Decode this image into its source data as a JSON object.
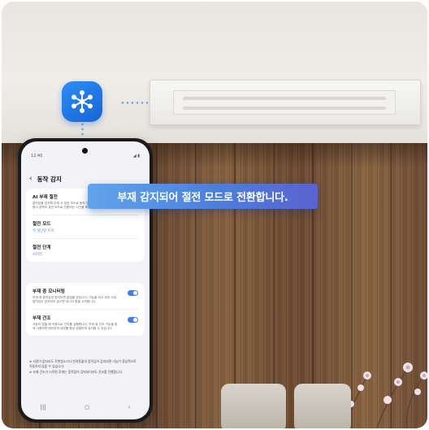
{
  "phone": {
    "status_time": "12:40",
    "status_icons": "◢ ▮",
    "header_title": "동작 감지",
    "ai_title": "AI 부재 절전",
    "ai_desc": "움직임을 감지해 부재 시 절전 모드로 동작 감지 바람 기능을 위한 사람이 공백이 절전 모드로 전환되는 시간을 확인합니다.",
    "mode_title": "절전 모드",
    "mode_value": "약 냉난방 유지",
    "level_title": "절전 단계",
    "level_value": "사이리",
    "monitor_title": "부재 중 모니터링",
    "monitor_desc": "부재 중 움직임이 감지되면 알림을 받습니다. 기능을 켜고 외부 이상 움직임이 감지되지 않으면 되니다 항을 시작합니다.",
    "dry_title": "부재 건조",
    "dry_desc": "사람이 없을 때 자동으로 건조를 실행합니다. 부재 중 건조 기능을 함께 사용하면 에어컨의 내부를 항상 청결하게 유지할 수 있습니다.",
    "note_1": "※ 사람이 없더라도 로봇청소기나 반려동물의 움직임이 감지되면 기능이 정상적으로 작동하지 않을 수 있습니다.",
    "note_2": "※ 부재 건조가 시작된 후에는 움직임이 감지되더라도 건조를 진행합니다.",
    "nav_recent": "|||",
    "nav_home": "○",
    "nav_back": "‹"
  },
  "callout": {
    "text": "부재 감지되어 절전 모드로 전환합니다."
  },
  "app_icon": "smartthings-icon",
  "colors": {
    "accent": "#3c7ff0",
    "callout_start": "#62a5ec",
    "callout_end": "#5a63cf",
    "wood": "#7a5538"
  }
}
